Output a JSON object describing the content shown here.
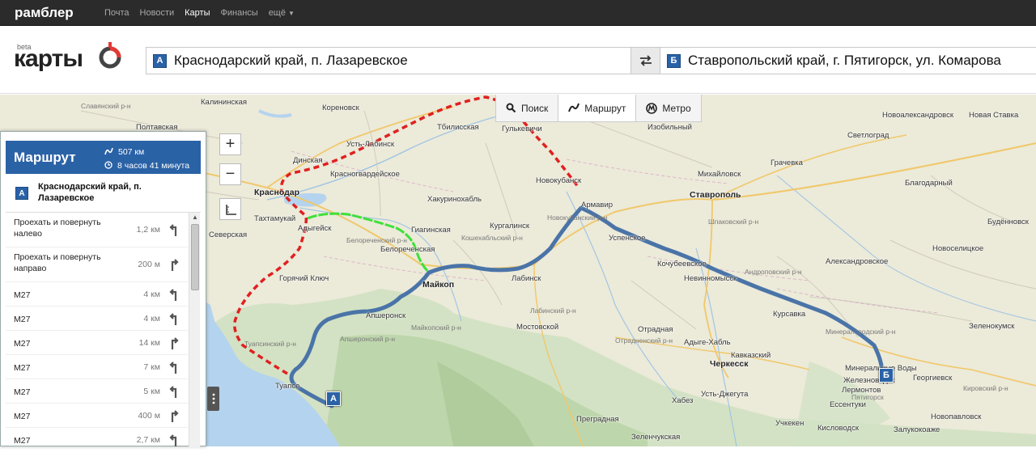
{
  "topbar": {
    "brand": "рамблер",
    "nav": [
      "Почта",
      "Новости",
      "Карты",
      "Финансы",
      "ещё"
    ],
    "active": "Карты"
  },
  "header": {
    "logo_beta": "beta",
    "logo_text": "карты",
    "from_pin": "А",
    "from_value": "Краснодарский край, п. Лазаревское",
    "to_pin": "Б",
    "to_value": "Ставропольский край, г. Пятигорск, ул. Комарова"
  },
  "modes": [
    {
      "label": "Поиск",
      "icon": "search-icon"
    },
    {
      "label": "Маршрут",
      "icon": "route-icon"
    },
    {
      "label": "Метро",
      "icon": "metro-icon"
    }
  ],
  "zoom": {
    "in": "+",
    "out": "−"
  },
  "panel": {
    "title": "Маршрут",
    "distance": "507 км",
    "duration": "8 часов 41 минута",
    "from_pin": "А",
    "from_text": "Краснодарский край, п. Лазаревское",
    "steps": [
      {
        "text": "Проехать и повернуть налево",
        "dist": "1,2 км",
        "turn": "left"
      },
      {
        "text": "Проехать и повернуть направо",
        "dist": "200 м",
        "turn": "right"
      },
      {
        "text": "M27",
        "dist": "4 км",
        "turn": "left"
      },
      {
        "text": "M27",
        "dist": "4 км",
        "turn": "left"
      },
      {
        "text": "M27",
        "dist": "14 км",
        "turn": "right"
      },
      {
        "text": "M27",
        "dist": "7 км",
        "turn": "left"
      },
      {
        "text": "M27",
        "dist": "5 км",
        "turn": "left"
      },
      {
        "text": "M27",
        "dist": "400 м",
        "turn": "right"
      },
      {
        "text": "M27",
        "dist": "2,7 км",
        "turn": "left"
      }
    ]
  },
  "map": {
    "pin_a": "А",
    "pin_b": "Б",
    "cities": [
      {
        "name": "Калининская",
        "big": false
      },
      {
        "name": "Полтавская",
        "big": false
      },
      {
        "name": "Славянский р-н",
        "big": false
      },
      {
        "name": "Кореновск",
        "big": false
      },
      {
        "name": "Тбилисская",
        "big": false
      },
      {
        "name": "Гулькевичи",
        "big": false
      },
      {
        "name": "Усть-Лабинск",
        "big": false
      },
      {
        "name": "Динская",
        "big": false
      },
      {
        "name": "Красногвардейское",
        "big": false
      },
      {
        "name": "Краснодар",
        "big": true
      },
      {
        "name": "Тахтамукай",
        "big": false
      },
      {
        "name": "Адыгейск",
        "big": false
      },
      {
        "name": "Северская",
        "big": false
      },
      {
        "name": "Горячий Ключ",
        "big": false
      },
      {
        "name": "Хакуринохабль",
        "big": false
      },
      {
        "name": "Гиагинская",
        "big": false
      },
      {
        "name": "Белореченская",
        "big": false
      },
      {
        "name": "Кургалинск",
        "big": false
      },
      {
        "name": "Майкоп",
        "big": true
      },
      {
        "name": "Лабинск",
        "big": false
      },
      {
        "name": "Апшеронск",
        "big": false
      },
      {
        "name": "Мостовской",
        "big": false
      },
      {
        "name": "Туапсе",
        "big": false
      },
      {
        "name": "Новокубанск",
        "big": false
      },
      {
        "name": "Армавир",
        "big": false
      },
      {
        "name": "Успенское",
        "big": false
      },
      {
        "name": "Ставрополь",
        "big": true
      },
      {
        "name": "Михайловск",
        "big": false
      },
      {
        "name": "Изобильный",
        "big": false
      },
      {
        "name": "Грачевка",
        "big": false
      },
      {
        "name": "Светлоград",
        "big": false
      },
      {
        "name": "Новоселицкое",
        "big": false
      },
      {
        "name": "Александровское",
        "big": false
      },
      {
        "name": "Невинномысск",
        "big": false
      },
      {
        "name": "Курсавка",
        "big": false
      },
      {
        "name": "Отрадная",
        "big": false
      },
      {
        "name": "Адыге-Хабль",
        "big": false
      },
      {
        "name": "Черкесск",
        "big": true
      },
      {
        "name": "Кавказский",
        "big": false
      },
      {
        "name": "Минеральные Воды",
        "big": false
      },
      {
        "name": "Георгиевск",
        "big": false
      },
      {
        "name": "Ессентуки",
        "big": false
      },
      {
        "name": "Кисловодск",
        "big": false
      },
      {
        "name": "Пятигорск",
        "big": false
      },
      {
        "name": "Учкекен",
        "big": false
      },
      {
        "name": "Зеленокумск",
        "big": false
      },
      {
        "name": "Новая Ставка",
        "big": false
      },
      {
        "name": "Благодарный",
        "big": false
      },
      {
        "name": "Новоалександровск",
        "big": false
      },
      {
        "name": "Кировский р-н",
        "big": false
      },
      {
        "name": "Новопавловск",
        "big": false
      },
      {
        "name": "Залукокоаже",
        "big": false
      },
      {
        "name": "Преградная",
        "big": false
      },
      {
        "name": "Хабез",
        "big": false
      },
      {
        "name": "Зеленчукская",
        "big": false
      },
      {
        "name": "Усть-Джегута",
        "big": false
      },
      {
        "name": "Кочубеевское",
        "big": false
      },
      {
        "name": "Андроповский р-н",
        "big": false
      },
      {
        "name": "Минераловодский р-н",
        "big": false
      },
      {
        "name": "Туапсинский р-н",
        "big": false
      },
      {
        "name": "Апшеронский р-н",
        "big": false
      },
      {
        "name": "Майкопский р-н",
        "big": false
      },
      {
        "name": "Лабинский р-н",
        "big": false
      },
      {
        "name": "Отрадненский р-н",
        "big": false
      },
      {
        "name": "Белореченский р-н",
        "big": false
      },
      {
        "name": "Кошехабльский р-н",
        "big": false
      },
      {
        "name": "Новокубанский р-н",
        "big": false
      },
      {
        "name": "Шпаковский р-н",
        "big": false
      },
      {
        "name": "Железноводск",
        "big": false
      },
      {
        "name": "Лермонтов",
        "big": false
      },
      {
        "name": "Будённовск",
        "big": false
      }
    ]
  }
}
